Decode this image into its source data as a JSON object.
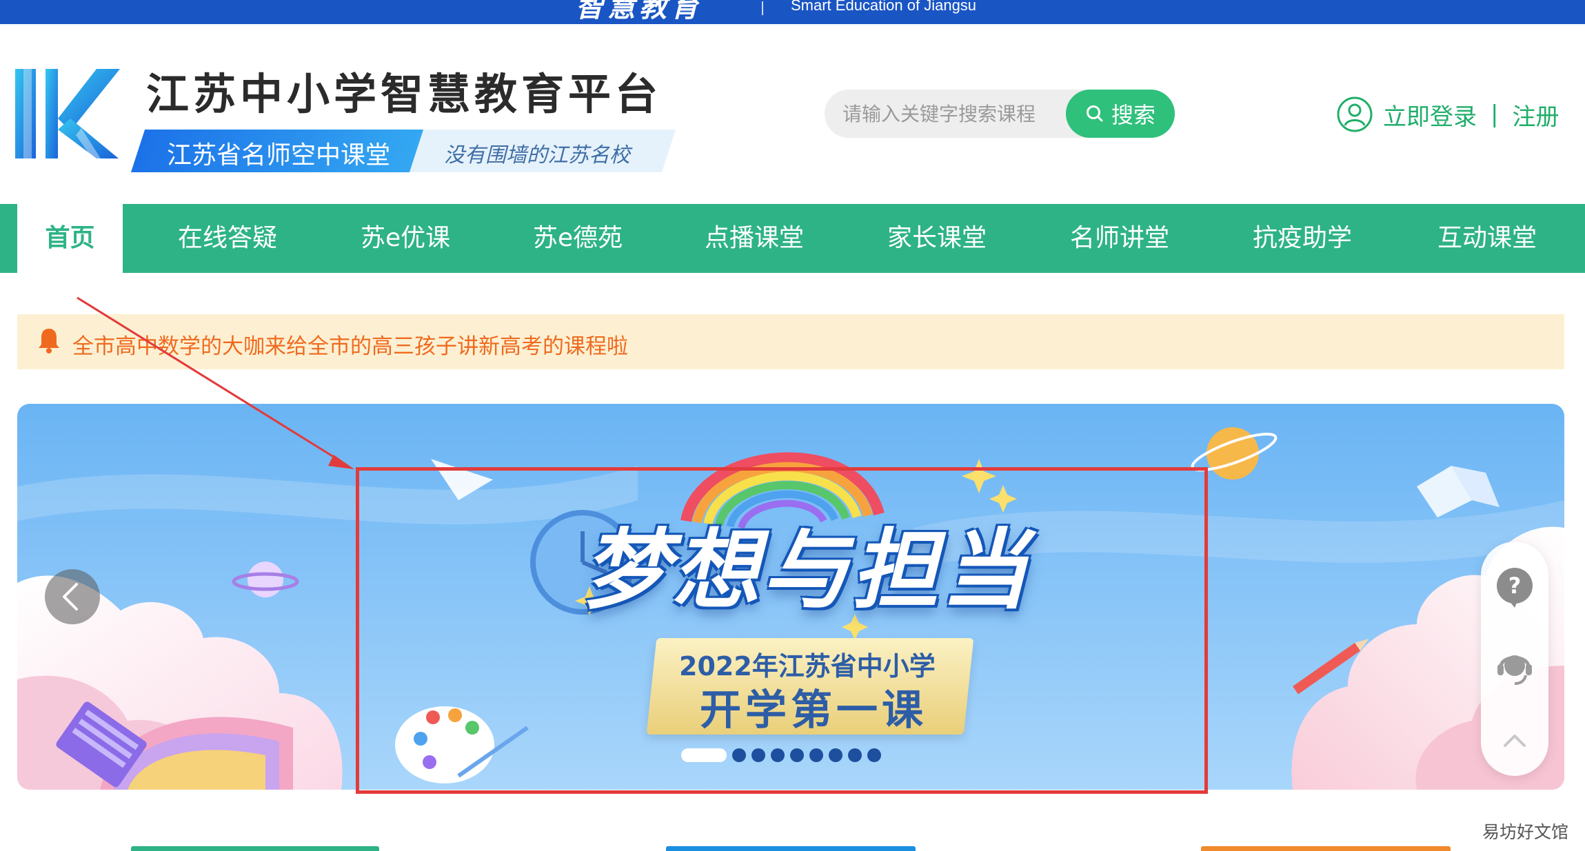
{
  "top_bar": {
    "title_cn": "智慧教育",
    "title_en": "Smart Education of Jiangsu"
  },
  "header": {
    "site_title": "江苏中小学智慧教育平台",
    "sub_badge": "江苏省名师空中课堂",
    "slogan": "没有围墙的江苏名校"
  },
  "search": {
    "placeholder": "请输入关键字搜索课程",
    "button_label": "搜索"
  },
  "account": {
    "login_label": "立即登录",
    "divider": "|",
    "register_label": "注册"
  },
  "nav": {
    "items": [
      {
        "label": "首页",
        "active": true
      },
      {
        "label": "在线答疑"
      },
      {
        "label": "苏e优课"
      },
      {
        "label": "苏e德苑"
      },
      {
        "label": "点播课堂"
      },
      {
        "label": "家长课堂"
      },
      {
        "label": "名师讲堂"
      },
      {
        "label": "抗疫助学"
      },
      {
        "label": "互动课堂"
      }
    ]
  },
  "notice": {
    "text": "全市高中数学的大咖来给全市的高三孩子讲新高考的课程啦"
  },
  "banner": {
    "title": "梦想与担当",
    "subtitle_line1": "2022年江苏省中小学",
    "subtitle_line2": "开学第一课",
    "slide_count": 9,
    "active_slide": 1
  },
  "watermark": "易坊好文馆",
  "colors": {
    "top_bar": "#1a55c4",
    "nav_green": "#2eb386",
    "search_green": "#2fc07c",
    "notice_bg": "#fdf0d2",
    "notice_text": "#ef6a1f",
    "annotation_red": "#e23b3b"
  },
  "icons": {
    "search": "search-icon",
    "user": "user-icon",
    "bell": "bell-icon",
    "prev": "chevron-left-icon",
    "help": "question-icon",
    "service": "headset-icon",
    "top": "chevron-up-icon"
  }
}
